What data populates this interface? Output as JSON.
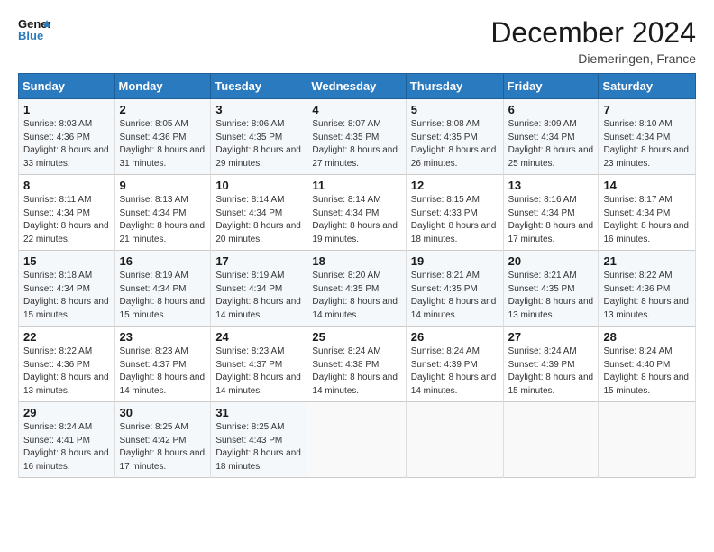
{
  "header": {
    "logo_line1": "General",
    "logo_line2": "Blue",
    "month": "December 2024",
    "location": "Diemeringen, France"
  },
  "weekdays": [
    "Sunday",
    "Monday",
    "Tuesday",
    "Wednesday",
    "Thursday",
    "Friday",
    "Saturday"
  ],
  "weeks": [
    [
      {
        "day": "1",
        "sunrise": "8:03 AM",
        "sunset": "4:36 PM",
        "daylight": "8 hours and 33 minutes."
      },
      {
        "day": "2",
        "sunrise": "8:05 AM",
        "sunset": "4:36 PM",
        "daylight": "8 hours and 31 minutes."
      },
      {
        "day": "3",
        "sunrise": "8:06 AM",
        "sunset": "4:35 PM",
        "daylight": "8 hours and 29 minutes."
      },
      {
        "day": "4",
        "sunrise": "8:07 AM",
        "sunset": "4:35 PM",
        "daylight": "8 hours and 27 minutes."
      },
      {
        "day": "5",
        "sunrise": "8:08 AM",
        "sunset": "4:35 PM",
        "daylight": "8 hours and 26 minutes."
      },
      {
        "day": "6",
        "sunrise": "8:09 AM",
        "sunset": "4:34 PM",
        "daylight": "8 hours and 25 minutes."
      },
      {
        "day": "7",
        "sunrise": "8:10 AM",
        "sunset": "4:34 PM",
        "daylight": "8 hours and 23 minutes."
      }
    ],
    [
      {
        "day": "8",
        "sunrise": "8:11 AM",
        "sunset": "4:34 PM",
        "daylight": "8 hours and 22 minutes."
      },
      {
        "day": "9",
        "sunrise": "8:13 AM",
        "sunset": "4:34 PM",
        "daylight": "8 hours and 21 minutes."
      },
      {
        "day": "10",
        "sunrise": "8:14 AM",
        "sunset": "4:34 PM",
        "daylight": "8 hours and 20 minutes."
      },
      {
        "day": "11",
        "sunrise": "8:14 AM",
        "sunset": "4:34 PM",
        "daylight": "8 hours and 19 minutes."
      },
      {
        "day": "12",
        "sunrise": "8:15 AM",
        "sunset": "4:33 PM",
        "daylight": "8 hours and 18 minutes."
      },
      {
        "day": "13",
        "sunrise": "8:16 AM",
        "sunset": "4:34 PM",
        "daylight": "8 hours and 17 minutes."
      },
      {
        "day": "14",
        "sunrise": "8:17 AM",
        "sunset": "4:34 PM",
        "daylight": "8 hours and 16 minutes."
      }
    ],
    [
      {
        "day": "15",
        "sunrise": "8:18 AM",
        "sunset": "4:34 PM",
        "daylight": "8 hours and 15 minutes."
      },
      {
        "day": "16",
        "sunrise": "8:19 AM",
        "sunset": "4:34 PM",
        "daylight": "8 hours and 15 minutes."
      },
      {
        "day": "17",
        "sunrise": "8:19 AM",
        "sunset": "4:34 PM",
        "daylight": "8 hours and 14 minutes."
      },
      {
        "day": "18",
        "sunrise": "8:20 AM",
        "sunset": "4:35 PM",
        "daylight": "8 hours and 14 minutes."
      },
      {
        "day": "19",
        "sunrise": "8:21 AM",
        "sunset": "4:35 PM",
        "daylight": "8 hours and 14 minutes."
      },
      {
        "day": "20",
        "sunrise": "8:21 AM",
        "sunset": "4:35 PM",
        "daylight": "8 hours and 13 minutes."
      },
      {
        "day": "21",
        "sunrise": "8:22 AM",
        "sunset": "4:36 PM",
        "daylight": "8 hours and 13 minutes."
      }
    ],
    [
      {
        "day": "22",
        "sunrise": "8:22 AM",
        "sunset": "4:36 PM",
        "daylight": "8 hours and 13 minutes."
      },
      {
        "day": "23",
        "sunrise": "8:23 AM",
        "sunset": "4:37 PM",
        "daylight": "8 hours and 14 minutes."
      },
      {
        "day": "24",
        "sunrise": "8:23 AM",
        "sunset": "4:37 PM",
        "daylight": "8 hours and 14 minutes."
      },
      {
        "day": "25",
        "sunrise": "8:24 AM",
        "sunset": "4:38 PM",
        "daylight": "8 hours and 14 minutes."
      },
      {
        "day": "26",
        "sunrise": "8:24 AM",
        "sunset": "4:39 PM",
        "daylight": "8 hours and 14 minutes."
      },
      {
        "day": "27",
        "sunrise": "8:24 AM",
        "sunset": "4:39 PM",
        "daylight": "8 hours and 15 minutes."
      },
      {
        "day": "28",
        "sunrise": "8:24 AM",
        "sunset": "4:40 PM",
        "daylight": "8 hours and 15 minutes."
      }
    ],
    [
      {
        "day": "29",
        "sunrise": "8:24 AM",
        "sunset": "4:41 PM",
        "daylight": "8 hours and 16 minutes."
      },
      {
        "day": "30",
        "sunrise": "8:25 AM",
        "sunset": "4:42 PM",
        "daylight": "8 hours and 17 minutes."
      },
      {
        "day": "31",
        "sunrise": "8:25 AM",
        "sunset": "4:43 PM",
        "daylight": "8 hours and 18 minutes."
      },
      null,
      null,
      null,
      null
    ]
  ]
}
